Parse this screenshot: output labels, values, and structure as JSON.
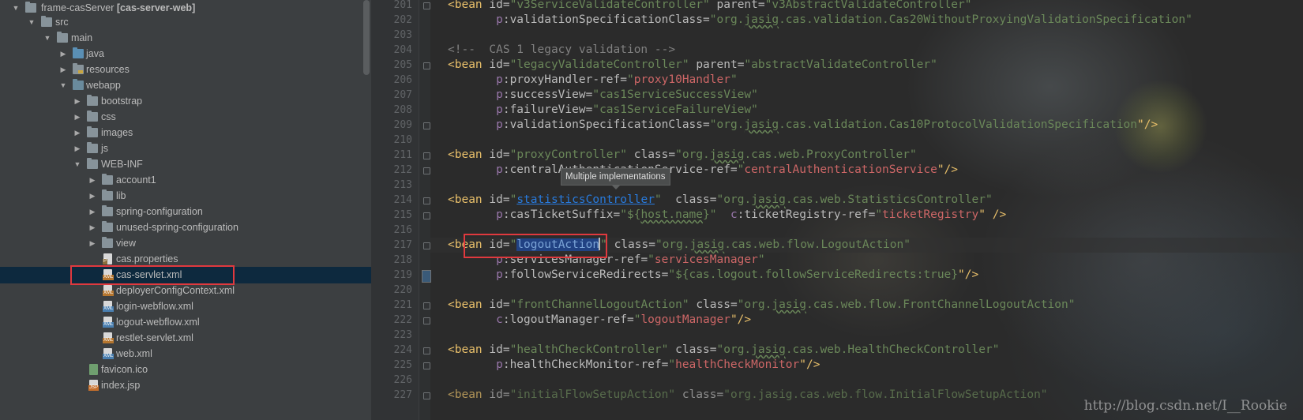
{
  "colors": {
    "highlight_red": "#e0393e",
    "selection": "#214283",
    "tree_selection": "#0d293e",
    "xml_tag": "#e8bf6a",
    "xml_string": "#6a8759",
    "xml_namespace": "#9876aa",
    "xml_ref": "#cc6666"
  },
  "project_tree": {
    "root": {
      "label": "frame-casServer",
      "module": "[cas-server-web]",
      "icon": "module-folder-icon"
    },
    "items": [
      {
        "label": "src",
        "icon": "folder-icon"
      },
      {
        "label": "main",
        "icon": "folder-icon"
      },
      {
        "label": "java",
        "icon": "source-folder-icon"
      },
      {
        "label": "resources",
        "icon": "resources-folder-icon"
      },
      {
        "label": "webapp",
        "icon": "web-folder-icon"
      },
      {
        "label": "bootstrap",
        "icon": "folder-icon"
      },
      {
        "label": "css",
        "icon": "folder-icon"
      },
      {
        "label": "images",
        "icon": "folder-icon"
      },
      {
        "label": "js",
        "icon": "folder-icon"
      },
      {
        "label": "WEB-INF",
        "icon": "folder-icon"
      },
      {
        "label": "account1",
        "icon": "folder-icon"
      },
      {
        "label": "lib",
        "icon": "folder-icon"
      },
      {
        "label": "spring-configuration",
        "icon": "folder-icon"
      },
      {
        "label": "unused-spring-configuration",
        "icon": "folder-icon"
      },
      {
        "label": "view",
        "icon": "folder-icon"
      },
      {
        "label": "cas.properties",
        "icon": "properties-file-icon"
      },
      {
        "label": "cas-servlet.xml",
        "icon": "xml-file-icon",
        "selected": true
      },
      {
        "label": "deployerConfigContext.xml",
        "icon": "xml-file-icon"
      },
      {
        "label": "login-webflow.xml",
        "icon": "webflow-xml-icon"
      },
      {
        "label": "logout-webflow.xml",
        "icon": "webflow-xml-icon"
      },
      {
        "label": "restlet-servlet.xml",
        "icon": "xml-file-icon"
      },
      {
        "label": "web.xml",
        "icon": "web-xml-icon"
      },
      {
        "label": "favicon.ico",
        "icon": "image-file-icon"
      },
      {
        "label": "index.jsp",
        "icon": "jsp-file-icon"
      }
    ]
  },
  "editor": {
    "line_numbers": [
      "201",
      "202",
      "203",
      "204",
      "205",
      "206",
      "207",
      "208",
      "209",
      "210",
      "211",
      "212",
      "213",
      "214",
      "215",
      "216",
      "217",
      "218",
      "219",
      "220",
      "221",
      "222",
      "223",
      "224",
      "225",
      "226",
      "227"
    ],
    "tooltip": "Multiple implementations",
    "watermark": "http://blog.csdn.net/I__Rookie",
    "tokens": {
      "bean": "<bean",
      "close_empty": "\"/>",
      "close_space_empty": "\" />",
      "l201_id_attr": "id=",
      "l201_id_val": "\"v3ServiceValidateController\"",
      "l201_parent_attr": "parent=",
      "l201_parent_val": "\"v3AbstractValidateController\"",
      "l202_ns": "p",
      "l202_attr": ":validationSpecificationClass=",
      "l202_val_a": "\"org.",
      "l202_val_typo": "jasig",
      "l202_val_b": ".cas.validation.Cas20WithoutProxyingValidationSpecification\"",
      "l204_comment": "<!--  CAS 1 legacy validation -->",
      "l205_id_attr": "id=",
      "l205_id_val": "\"legacyValidateController\"",
      "l205_parent_attr": "parent=",
      "l205_parent_val": "\"abstractValidateController\"",
      "l206_ns": "p",
      "l206_attr": ":proxyHandler-ref=",
      "l206_q": "\"",
      "l206_ref": "proxy10Handler",
      "l207_ns": "p",
      "l207_attr": ":successView=",
      "l207_val": "\"cas1ServiceSuccessView\"",
      "l208_ns": "p",
      "l208_attr": ":failureView=",
      "l208_val": "\"cas1ServiceFailureView\"",
      "l209_ns": "p",
      "l209_attr": ":validationSpecificationClass=",
      "l209_val_a": "\"org.",
      "l209_val_typo": "jasig",
      "l209_val_b": ".cas.validation.Cas10ProtocolValidationSpecification",
      "l211_id_attr": "id=",
      "l211_id_val": "\"proxyController\"",
      "l211_class_attr": "class=",
      "l211_class_a": "\"org.",
      "l211_class_typo": "jasig",
      "l211_class_b": ".cas.web.ProxyController\"",
      "l212_ns": "p",
      "l212_attr": ":centralAuthenticationService-ref=",
      "l212_q": "\"",
      "l212_ref": "centralAuthenticationService",
      "l214_id_attr": "id=",
      "l214_q": "\"",
      "l214_link": "statisticsController",
      "l214_class_attr": "class=",
      "l214_class_a": "\"org.",
      "l214_class_typo": "jasig",
      "l214_class_b": ".cas.web.StatisticsController\"",
      "l215_ns": "p",
      "l215_attr": ":casTicketSuffix=",
      "l215_val_a": "\"${",
      "l215_val_typo": "host.name",
      "l215_val_b": "}\"",
      "l215_ns2": "c",
      "l215_attr2": ":ticketRegistry-ref=",
      "l215_q": "\"",
      "l215_ref": "ticketRegistry",
      "l217_id_attr": "id=",
      "l217_q": "\"",
      "l217_sel": "logoutAction",
      "l217_q2": "\"",
      "l217_class_attr": "class=",
      "l217_class_a": "\"org.",
      "l217_class_typo": "jasig",
      "l217_class_b": ".cas.web.flow.LogoutAction\"",
      "l218_ns": "p",
      "l218_attr": ":servicesManager-ref=",
      "l218_q": "\"",
      "l218_ref": "servicesManager",
      "l219_ns": "p",
      "l219_attr": ":followServiceRedirects=",
      "l219_val": "\"${cas.logout.followServiceRedirects:true}",
      "l221_id_attr": "id=",
      "l221_id_val": "\"frontChannelLogoutAction\"",
      "l221_class_attr": "class=",
      "l221_class_a": "\"org.",
      "l221_class_typo": "jasig",
      "l221_class_b": ".cas.web.flow.FrontChannelLogoutAction\"",
      "l222_ns": "c",
      "l222_attr": ":logoutManager-ref=",
      "l222_q": "\"",
      "l222_ref": "logoutManager",
      "l224_id_attr": "id=",
      "l224_id_val": "\"healthCheckController\"",
      "l224_class_attr": "class=",
      "l224_class_a": "\"org.",
      "l224_class_typo": "jasig",
      "l224_class_b": ".cas.web.HealthCheckController\"",
      "l225_ns": "p",
      "l225_attr": ":healthCheckMonitor-ref=",
      "l225_q": "\"",
      "l225_ref": "healthCheckMonitor",
      "l227_id_attr": "id=",
      "l227_id_val": "\"initialFlowSetupAction\"",
      "l227_class_attr": "class=",
      "l227_class_val": "\"org.jasig.cas.web.flow.InitialFlowSetupAction\""
    }
  }
}
